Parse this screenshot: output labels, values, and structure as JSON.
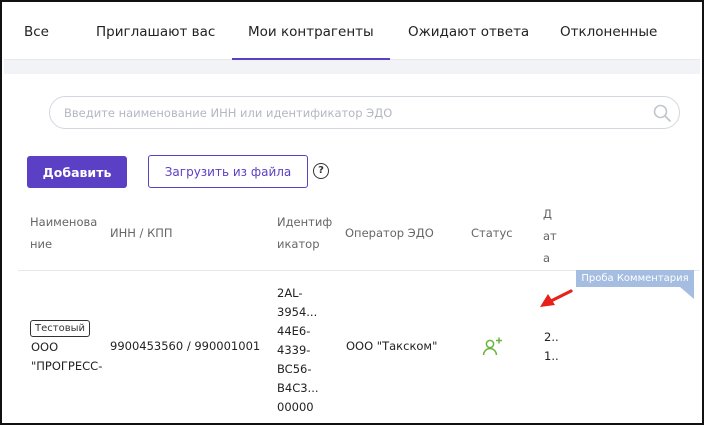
{
  "tabs": [
    {
      "label": "Все"
    },
    {
      "label": "Приглашают вас"
    },
    {
      "label": "Мои контрагенты",
      "active": true
    },
    {
      "label": "Ожидают ответа"
    },
    {
      "label": "Отклоненные"
    }
  ],
  "search": {
    "placeholder": "Введите наименование ИНН или идентификатор ЭДО",
    "value": ""
  },
  "toolbar": {
    "add_label": "Добавить",
    "upload_label": "Загрузить из файла",
    "help_glyph": "?"
  },
  "table": {
    "columns": [
      "Наименова\nние",
      "ИНН / КПП",
      "Идентиф\nикатор",
      "Оператор ЭДО",
      "Статус",
      "Д\nат\nа"
    ],
    "rows": [
      {
        "tag": "Тестовый",
        "name_lines": [
          "ООО",
          "\"ПРОГРЕСС-"
        ],
        "inn_kpp": "9900453560 / 990001001",
        "identifier_lines": [
          "2AL-",
          "3954...",
          "44E6-",
          "4339-",
          "BC56-",
          "B4C3...",
          "00000"
        ],
        "operator": "ООО \"Такском\"",
        "status_icon": "user-add-icon",
        "date_lines": [
          "2..",
          "1.."
        ]
      }
    ]
  },
  "comment": {
    "label": "Проба Комментария"
  },
  "colors": {
    "accent": "#5b3fc4",
    "status_green": "#6cb33f",
    "comment_bg": "#a5bde0",
    "arrow_red": "#e8201a"
  }
}
